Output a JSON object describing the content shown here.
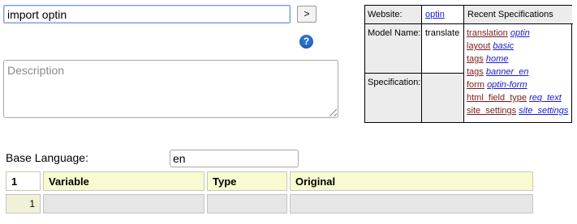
{
  "command": {
    "value": "import optin",
    "go_label": ">"
  },
  "help_icon": "?",
  "description": {
    "placeholder": "Description",
    "value": ""
  },
  "info_table": {
    "website_label": "Website:",
    "website_value": "optin",
    "model_name_label": "Model Name:",
    "model_name_value": "translate",
    "specification_label": "Specification:",
    "recent_header": "Recent Specifications",
    "recent": [
      {
        "type": "translation",
        "name": "optin"
      },
      {
        "type": "layout",
        "name": "basic"
      },
      {
        "type": "tags",
        "name": "home"
      },
      {
        "type": "tags",
        "name": "banner_en"
      },
      {
        "type": "form",
        "name": "optin-form"
      },
      {
        "type": "html_field_type",
        "name": "req_text"
      },
      {
        "type": "site_settings",
        "name": "site_settings"
      }
    ]
  },
  "base_language": {
    "label": "Base Language:",
    "value": "en"
  },
  "grid": {
    "count": "1",
    "columns": [
      "Variable",
      "Type",
      "Original"
    ],
    "rows": [
      {
        "index": "1",
        "variable": "",
        "type": "",
        "original": ""
      }
    ]
  },
  "colors": {
    "header_bg": "#fafad2",
    "row_bg": "#e6e6e6",
    "link": "#1a1acc",
    "spec_type": "#7b1d1d",
    "help_icon": "#2a6fd1"
  }
}
